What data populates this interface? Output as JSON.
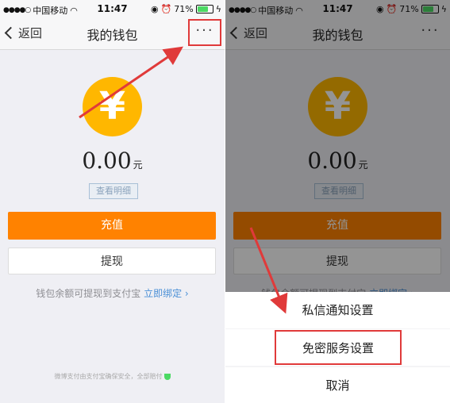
{
  "status_bar": {
    "carrier": "中国移动",
    "time": "11:47",
    "battery": "71%"
  },
  "nav": {
    "back_label": "返回",
    "title": "我的钱包",
    "more_label": "···"
  },
  "wallet": {
    "currency_symbol": "¥",
    "balance": "0.00",
    "unit": "元",
    "detail_label": "查看明细",
    "recharge_label": "充值",
    "withdraw_label": "提现",
    "note_text": "钱包余额可提现到支付宝",
    "bind_link": "立即绑定 ›",
    "footer_text": "微博支付由支付宝确保安全，全部赔付"
  },
  "action_sheet": {
    "items": [
      {
        "label": "私信通知设置"
      },
      {
        "label": "免密服务设置"
      }
    ],
    "cancel_label": "取消"
  },
  "colors": {
    "accent_orange": "#ff8200",
    "coin_yellow": "#ffb700",
    "annotation_red": "#e03a3a",
    "link_blue": "#4a8fd6"
  }
}
